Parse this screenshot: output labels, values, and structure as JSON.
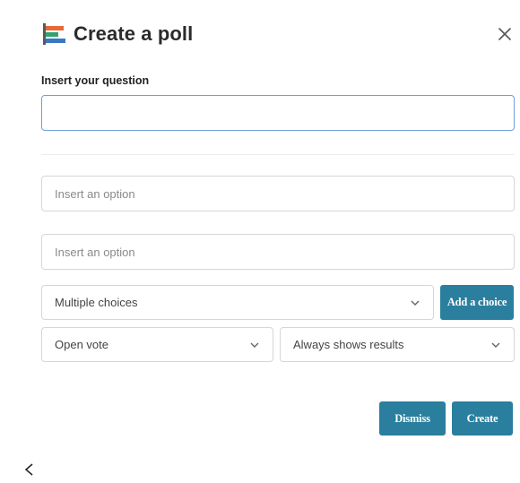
{
  "dialog": {
    "title": "Create a poll",
    "icon": "poll-chart-icon",
    "colors": {
      "accent": "#2a7f9e",
      "focus_border": "#6f9fd8",
      "icon_orange": "#e7683a",
      "icon_green": "#33a36f",
      "icon_blue": "#3a78c2"
    }
  },
  "question": {
    "label": "Insert your question",
    "value": "",
    "placeholder": ""
  },
  "options": [
    {
      "placeholder": "Insert an option",
      "value": ""
    },
    {
      "placeholder": "Insert an option",
      "value": ""
    }
  ],
  "selects": {
    "choice_type": "Multiple choices",
    "vote_type": "Open vote",
    "results_visibility": "Always shows results"
  },
  "buttons": {
    "add_choice": "Add a choice",
    "dismiss": "Dismiss",
    "create": "Create"
  },
  "footer": {
    "back_glyph": "<"
  }
}
